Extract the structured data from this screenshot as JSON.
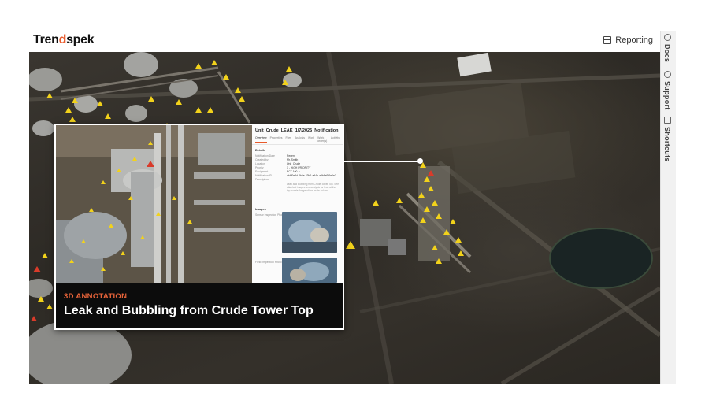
{
  "app": {
    "logo_text_prefix": "Tren",
    "logo_text_accent": "d",
    "logo_text_suffix": "spek"
  },
  "header": {
    "reporting_label": "Reporting",
    "reporting_icon": "table-icon"
  },
  "rail": {
    "items": [
      {
        "label": "Docs",
        "icon": "docs-icon"
      },
      {
        "label": "Support",
        "icon": "support-icon"
      },
      {
        "label": "Shortcuts",
        "icon": "keyboard-icon"
      }
    ]
  },
  "notification": {
    "title": "Unit_Crude_LEAK_1/7/2025_Notification",
    "tabs": [
      "Overview",
      "Properties",
      "Files",
      "Analysis",
      "Work",
      "Work order(s)",
      "Activity"
    ],
    "details_heading": "Details",
    "fields": [
      {
        "key": "Notification Date",
        "value": "Recent"
      },
      {
        "key": "Created by",
        "value": "Mr. Smith"
      },
      {
        "key": "Location",
        "value": "Unit_Crude"
      },
      {
        "key": "Priority",
        "value": "1 - HIGH PRIORITY"
      },
      {
        "key": "Equipment",
        "value": "BCT-100-A"
      },
      {
        "key": "Notification ID",
        "value": "cb4f0e8d-2b6e-43b6-a94b-a3b6a9f6e0e7"
      }
    ],
    "description_label": "Description",
    "description_text": "Leak and Bubbling from Crude Tower Top. See attached images and analysis for leak at the top nozzle flange of the crude column.",
    "images_heading": "Images",
    "images_label_1": "Sensor Inspection Photo",
    "images_label_2": "Field Inspection Photo"
  },
  "caption": {
    "kicker": "3D ANNOTATION",
    "title": "Leak and Bubbling from Crude Tower Top"
  },
  "colors": {
    "accent": "#e8643a",
    "marker": "#f2d21b",
    "alert_marker": "#d93b2a"
  }
}
